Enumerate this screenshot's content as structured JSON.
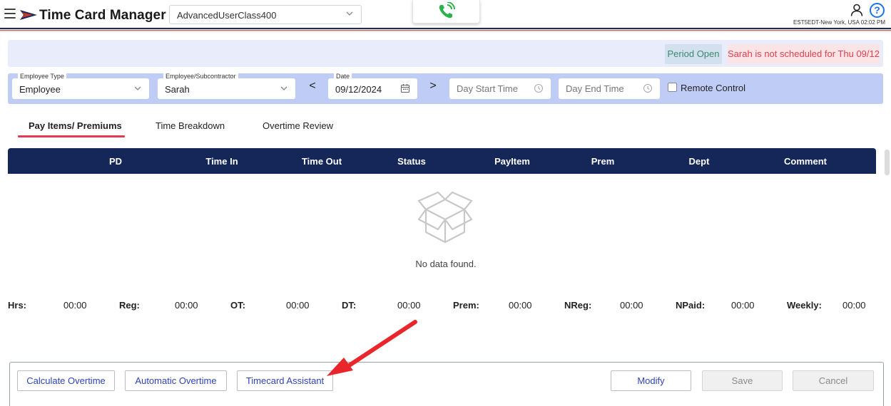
{
  "header": {
    "app_title": "Time Card Manager",
    "class_select_value": "AdvancedUserClass400",
    "timezone": "EST5EDT-New York, USA 02:02 PM",
    "help_glyph": "?"
  },
  "banner": {
    "period_status": "Period Open",
    "schedule_alert": "Sarah is not scheduled for Thu 09/12"
  },
  "filters": {
    "employee_type": {
      "label": "Employee Type",
      "value": "Employee"
    },
    "employee": {
      "label": "Employee/Subcontractor",
      "value": "Sarah"
    },
    "date": {
      "label": "Date",
      "value": "09/12/2024"
    },
    "prev_glyph": "<",
    "next_glyph": ">",
    "day_start_placeholder": "Day Start Time",
    "day_end_placeholder": "Day End Time",
    "remote_control_label": "Remote Control"
  },
  "tabs": [
    {
      "label": "Pay Items/ Premiums",
      "active": true
    },
    {
      "label": "Time Breakdown",
      "active": false
    },
    {
      "label": "Overtime Review",
      "active": false
    }
  ],
  "grid": {
    "columns": [
      "PD",
      "Time In",
      "Time Out",
      "Status",
      "PayItem",
      "Prem",
      "Dept",
      "Comment"
    ],
    "empty_text": "No data found."
  },
  "totals": [
    {
      "label": "Hrs:",
      "value": "00:00"
    },
    {
      "label": "Reg:",
      "value": "00:00"
    },
    {
      "label": "OT:",
      "value": "00:00"
    },
    {
      "label": "DT:",
      "value": "00:00"
    },
    {
      "label": "Prem:",
      "value": "00:00"
    },
    {
      "label": "NReg:",
      "value": "00:00"
    },
    {
      "label": "NPaid:",
      "value": "00:00"
    },
    {
      "label": "Weekly:",
      "value": "00:00"
    }
  ],
  "buttons": {
    "calculate_overtime": "Calculate Overtime",
    "automatic_overtime": "Automatic Overtime",
    "timecard_assistant": "Timecard Assistant",
    "modify": "Modify",
    "save": "Save",
    "cancel": "Cancel"
  },
  "colors": {
    "header_navy": "#152759",
    "accent_red": "#e53950",
    "filter_bar": "#bfcdf6",
    "banner_bg": "#e8ecfb",
    "link_blue": "#2e43b8",
    "phone_green": "#2bb24c",
    "annotation_arrow": "#e8262b"
  },
  "icons": {
    "menu": "hamburger-icon",
    "logo": "arrow-logo",
    "phone": "phone-ringing-icon",
    "user": "user-icon",
    "help": "help-icon",
    "calendar": "calendar-icon",
    "clock": "clock-icon",
    "empty": "empty-box-icon"
  }
}
